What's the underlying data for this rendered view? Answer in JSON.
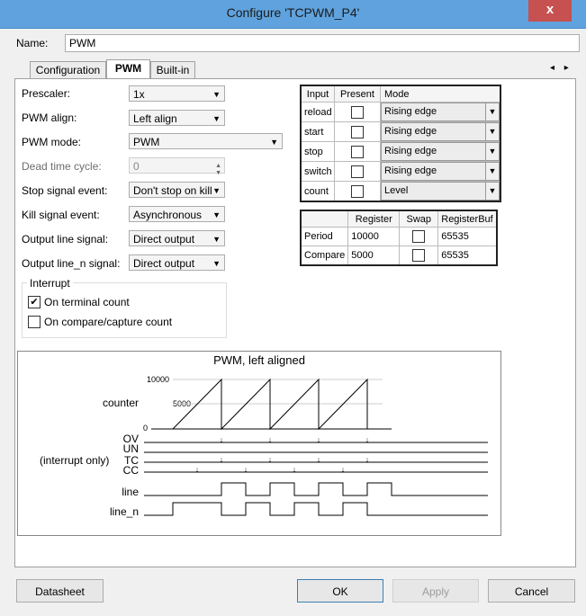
{
  "window": {
    "title": "Configure 'TCPWM_P4'",
    "close_glyph": "x"
  },
  "name": {
    "label": "Name:",
    "value": "PWM"
  },
  "tabs": [
    {
      "label": "Configuration"
    },
    {
      "label": "PWM"
    },
    {
      "label": "Built-in"
    }
  ],
  "tab_arrows": "◂ ▸",
  "form": {
    "prescaler": {
      "label": "Prescaler:",
      "value": "1x"
    },
    "pwm_align": {
      "label": "PWM align:",
      "value": "Left align"
    },
    "pwm_mode": {
      "label": "PWM mode:",
      "value": "PWM"
    },
    "dead_time": {
      "label": "Dead time cycle:",
      "value": "0"
    },
    "stop_signal": {
      "label": "Stop signal event:",
      "value": "Don't stop on kill"
    },
    "kill_signal": {
      "label": "Kill signal event:",
      "value": "Asynchronous"
    },
    "output_line": {
      "label": "Output line signal:",
      "value": "Direct output"
    },
    "output_line_n": {
      "label": "Output line_n signal:",
      "value": "Direct output"
    }
  },
  "interrupt": {
    "title": "Interrupt",
    "on_terminal_count": {
      "label": "On terminal count",
      "checked": true
    },
    "on_compare": {
      "label": "On compare/capture count",
      "checked": false
    }
  },
  "input_table": {
    "headers": [
      "Input",
      "Present",
      "Mode"
    ],
    "rows": [
      {
        "input": "reload",
        "present": false,
        "mode": "Rising edge"
      },
      {
        "input": "start",
        "present": false,
        "mode": "Rising edge"
      },
      {
        "input": "stop",
        "present": false,
        "mode": "Rising edge"
      },
      {
        "input": "switch",
        "present": false,
        "mode": "Rising edge"
      },
      {
        "input": "count",
        "present": false,
        "mode": "Level"
      }
    ]
  },
  "register_table": {
    "headers": [
      "",
      "Register",
      "Swap",
      "RegisterBuf"
    ],
    "rows": [
      {
        "name": "Period",
        "register": "10000",
        "swap": false,
        "buf": "65535"
      },
      {
        "name": "Compare",
        "register": "5000",
        "swap": false,
        "buf": "65535"
      }
    ]
  },
  "diagram": {
    "title": "PWM, left aligned",
    "counter_label": "counter",
    "ticks": [
      "10000",
      "5000",
      "0"
    ],
    "signals": [
      "OV",
      "UN",
      "TC",
      "CC"
    ],
    "interrupt_note": "(interrupt only)",
    "line_label": "line",
    "line_n_label": "line_n"
  },
  "buttons": {
    "datasheet": "Datasheet",
    "ok": "OK",
    "apply": "Apply",
    "cancel": "Cancel"
  }
}
